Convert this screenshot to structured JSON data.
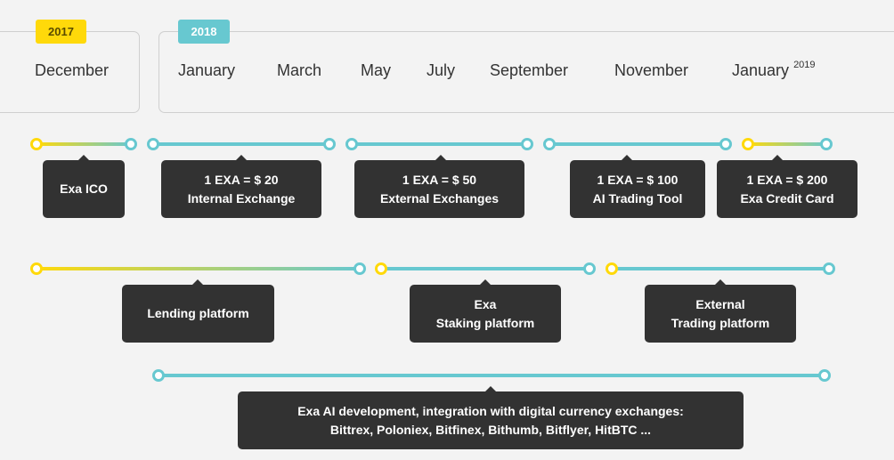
{
  "years": {
    "y2017": {
      "badge": "2017",
      "months": [
        "December"
      ]
    },
    "y2018": {
      "badge": "2018",
      "months": [
        "January",
        "March",
        "May",
        "July",
        "September",
        "November"
      ],
      "next_month": "January",
      "next_year": "2019"
    }
  },
  "colors": {
    "yellow": "#ffd90a",
    "teal": "#67c8d0",
    "tooltip_bg": "#323232",
    "background": "#f3f3f3"
  },
  "milestones": [
    {
      "lines": [
        "Exa ICO"
      ]
    },
    {
      "lines": [
        "1 EXA = $ 20",
        "Internal Exchange"
      ]
    },
    {
      "lines": [
        "1 EXA = $ 50",
        "External Exchanges"
      ]
    },
    {
      "lines": [
        "1 EXA = $ 100",
        "AI Trading Tool"
      ]
    },
    {
      "lines": [
        "1 EXA = $ 200",
        "Exa Credit Card"
      ]
    },
    {
      "lines": [
        "Lending platform"
      ]
    },
    {
      "lines": [
        "Exa",
        "Staking platform"
      ]
    },
    {
      "lines": [
        "External",
        "Trading platform"
      ]
    },
    {
      "lines": [
        "Exa AI development, integration with digital currency exchanges:",
        "Bittrex, Poloniex, Bitfinex, Bithumb, Bitflyer, HitBTC ..."
      ]
    }
  ]
}
